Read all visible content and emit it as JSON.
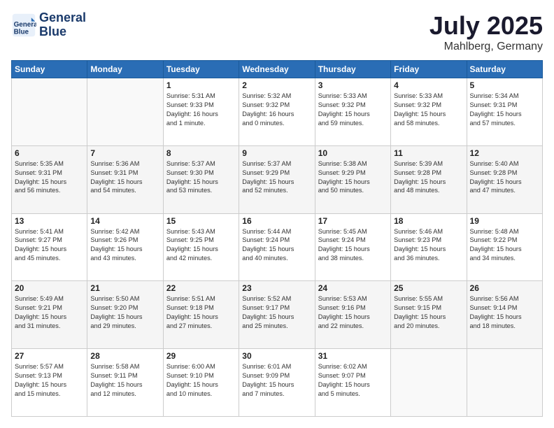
{
  "header": {
    "logo_line1": "General",
    "logo_line2": "Blue",
    "title": "July 2025",
    "subtitle": "Mahlberg, Germany"
  },
  "weekdays": [
    "Sunday",
    "Monday",
    "Tuesday",
    "Wednesday",
    "Thursday",
    "Friday",
    "Saturday"
  ],
  "weeks": [
    [
      {
        "day": "",
        "info": ""
      },
      {
        "day": "",
        "info": ""
      },
      {
        "day": "1",
        "info": "Sunrise: 5:31 AM\nSunset: 9:33 PM\nDaylight: 16 hours\nand 1 minute."
      },
      {
        "day": "2",
        "info": "Sunrise: 5:32 AM\nSunset: 9:32 PM\nDaylight: 16 hours\nand 0 minutes."
      },
      {
        "day": "3",
        "info": "Sunrise: 5:33 AM\nSunset: 9:32 PM\nDaylight: 15 hours\nand 59 minutes."
      },
      {
        "day": "4",
        "info": "Sunrise: 5:33 AM\nSunset: 9:32 PM\nDaylight: 15 hours\nand 58 minutes."
      },
      {
        "day": "5",
        "info": "Sunrise: 5:34 AM\nSunset: 9:31 PM\nDaylight: 15 hours\nand 57 minutes."
      }
    ],
    [
      {
        "day": "6",
        "info": "Sunrise: 5:35 AM\nSunset: 9:31 PM\nDaylight: 15 hours\nand 56 minutes."
      },
      {
        "day": "7",
        "info": "Sunrise: 5:36 AM\nSunset: 9:31 PM\nDaylight: 15 hours\nand 54 minutes."
      },
      {
        "day": "8",
        "info": "Sunrise: 5:37 AM\nSunset: 9:30 PM\nDaylight: 15 hours\nand 53 minutes."
      },
      {
        "day": "9",
        "info": "Sunrise: 5:37 AM\nSunset: 9:29 PM\nDaylight: 15 hours\nand 52 minutes."
      },
      {
        "day": "10",
        "info": "Sunrise: 5:38 AM\nSunset: 9:29 PM\nDaylight: 15 hours\nand 50 minutes."
      },
      {
        "day": "11",
        "info": "Sunrise: 5:39 AM\nSunset: 9:28 PM\nDaylight: 15 hours\nand 48 minutes."
      },
      {
        "day": "12",
        "info": "Sunrise: 5:40 AM\nSunset: 9:28 PM\nDaylight: 15 hours\nand 47 minutes."
      }
    ],
    [
      {
        "day": "13",
        "info": "Sunrise: 5:41 AM\nSunset: 9:27 PM\nDaylight: 15 hours\nand 45 minutes."
      },
      {
        "day": "14",
        "info": "Sunrise: 5:42 AM\nSunset: 9:26 PM\nDaylight: 15 hours\nand 43 minutes."
      },
      {
        "day": "15",
        "info": "Sunrise: 5:43 AM\nSunset: 9:25 PM\nDaylight: 15 hours\nand 42 minutes."
      },
      {
        "day": "16",
        "info": "Sunrise: 5:44 AM\nSunset: 9:24 PM\nDaylight: 15 hours\nand 40 minutes."
      },
      {
        "day": "17",
        "info": "Sunrise: 5:45 AM\nSunset: 9:24 PM\nDaylight: 15 hours\nand 38 minutes."
      },
      {
        "day": "18",
        "info": "Sunrise: 5:46 AM\nSunset: 9:23 PM\nDaylight: 15 hours\nand 36 minutes."
      },
      {
        "day": "19",
        "info": "Sunrise: 5:48 AM\nSunset: 9:22 PM\nDaylight: 15 hours\nand 34 minutes."
      }
    ],
    [
      {
        "day": "20",
        "info": "Sunrise: 5:49 AM\nSunset: 9:21 PM\nDaylight: 15 hours\nand 31 minutes."
      },
      {
        "day": "21",
        "info": "Sunrise: 5:50 AM\nSunset: 9:20 PM\nDaylight: 15 hours\nand 29 minutes."
      },
      {
        "day": "22",
        "info": "Sunrise: 5:51 AM\nSunset: 9:18 PM\nDaylight: 15 hours\nand 27 minutes."
      },
      {
        "day": "23",
        "info": "Sunrise: 5:52 AM\nSunset: 9:17 PM\nDaylight: 15 hours\nand 25 minutes."
      },
      {
        "day": "24",
        "info": "Sunrise: 5:53 AM\nSunset: 9:16 PM\nDaylight: 15 hours\nand 22 minutes."
      },
      {
        "day": "25",
        "info": "Sunrise: 5:55 AM\nSunset: 9:15 PM\nDaylight: 15 hours\nand 20 minutes."
      },
      {
        "day": "26",
        "info": "Sunrise: 5:56 AM\nSunset: 9:14 PM\nDaylight: 15 hours\nand 18 minutes."
      }
    ],
    [
      {
        "day": "27",
        "info": "Sunrise: 5:57 AM\nSunset: 9:13 PM\nDaylight: 15 hours\nand 15 minutes."
      },
      {
        "day": "28",
        "info": "Sunrise: 5:58 AM\nSunset: 9:11 PM\nDaylight: 15 hours\nand 12 minutes."
      },
      {
        "day": "29",
        "info": "Sunrise: 6:00 AM\nSunset: 9:10 PM\nDaylight: 15 hours\nand 10 minutes."
      },
      {
        "day": "30",
        "info": "Sunrise: 6:01 AM\nSunset: 9:09 PM\nDaylight: 15 hours\nand 7 minutes."
      },
      {
        "day": "31",
        "info": "Sunrise: 6:02 AM\nSunset: 9:07 PM\nDaylight: 15 hours\nand 5 minutes."
      },
      {
        "day": "",
        "info": ""
      },
      {
        "day": "",
        "info": ""
      }
    ]
  ]
}
